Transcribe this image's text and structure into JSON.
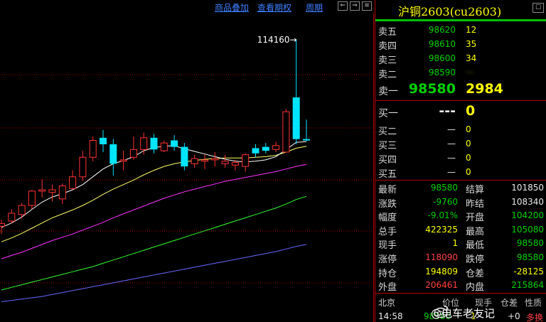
{
  "toolbar": {
    "overlay_label": "商品叠加",
    "periods_label": "查看期权",
    "cycle_label": "周期",
    "nav_left": "⇐",
    "nav_right": "⇒",
    "nav_menu": "≡"
  },
  "chart": {
    "peak_annotation": "114160→"
  },
  "colors": {
    "up_candle": "#ff3333",
    "down_candle": "#00e5ff",
    "ma_fast": "#ffffff",
    "ma_mid": "#ffff66",
    "ma_slow": "#ff33ff",
    "ma_long": "#33ff33",
    "ma_longest": "#6666ff",
    "grid": "#a00000"
  },
  "chart_data": {
    "type": "candlestick",
    "title": "",
    "candles": [
      {
        "o": 85400,
        "h": 86400,
        "l": 84200,
        "c": 85800
      },
      {
        "o": 86200,
        "h": 88000,
        "l": 85800,
        "c": 87400
      },
      {
        "o": 87200,
        "h": 89000,
        "l": 86600,
        "c": 88600
      },
      {
        "o": 88600,
        "h": 91000,
        "l": 88000,
        "c": 90800
      },
      {
        "o": 90800,
        "h": 92600,
        "l": 89800,
        "c": 91000
      },
      {
        "o": 90600,
        "h": 91800,
        "l": 89200,
        "c": 91000
      },
      {
        "o": 89600,
        "h": 92000,
        "l": 88800,
        "c": 91600
      },
      {
        "o": 91200,
        "h": 94000,
        "l": 91000,
        "c": 93000
      },
      {
        "o": 93000,
        "h": 97000,
        "l": 92400,
        "c": 96000
      },
      {
        "o": 96000,
        "h": 99200,
        "l": 95400,
        "c": 98600
      },
      {
        "o": 99000,
        "h": 100200,
        "l": 96800,
        "c": 98000
      },
      {
        "o": 98000,
        "h": 98800,
        "l": 93200,
        "c": 95000
      },
      {
        "o": 95400,
        "h": 97000,
        "l": 94000,
        "c": 95600
      },
      {
        "o": 96000,
        "h": 99200,
        "l": 95600,
        "c": 97200
      },
      {
        "o": 97200,
        "h": 99800,
        "l": 96400,
        "c": 99000
      },
      {
        "o": 99000,
        "h": 99600,
        "l": 96600,
        "c": 97200
      },
      {
        "o": 97000,
        "h": 98600,
        "l": 96800,
        "c": 98200
      },
      {
        "o": 98600,
        "h": 99400,
        "l": 97000,
        "c": 97600
      },
      {
        "o": 97600,
        "h": 98200,
        "l": 94000,
        "c": 94600
      },
      {
        "o": 95000,
        "h": 96400,
        "l": 94400,
        "c": 95800
      },
      {
        "o": 95400,
        "h": 96400,
        "l": 94200,
        "c": 95600
      },
      {
        "o": 95600,
        "h": 96800,
        "l": 94600,
        "c": 95800
      },
      {
        "o": 95000,
        "h": 96400,
        "l": 94400,
        "c": 95400
      },
      {
        "o": 94800,
        "h": 95600,
        "l": 94000,
        "c": 95200
      },
      {
        "o": 94600,
        "h": 96600,
        "l": 93800,
        "c": 96400
      },
      {
        "o": 97400,
        "h": 98000,
        "l": 96000,
        "c": 96600
      },
      {
        "o": 97600,
        "h": 98200,
        "l": 96600,
        "c": 97000
      },
      {
        "o": 97200,
        "h": 98400,
        "l": 96800,
        "c": 97800
      },
      {
        "o": 96800,
        "h": 103400,
        "l": 96800,
        "c": 103000
      },
      {
        "o": 105200,
        "h": 114160,
        "l": 98000,
        "c": 98800
      },
      {
        "o": 98800,
        "h": 101800,
        "l": 98500,
        "c": 98580
      }
    ],
    "ma_fast": [
      85200,
      85900,
      86800,
      88000,
      89100,
      89900,
      90400,
      91000,
      91800,
      93000,
      94200,
      95000,
      95500,
      96100,
      97000,
      97500,
      97700,
      97800,
      97300,
      96900,
      96500,
      96100,
      95700,
      95400,
      95300,
      95400,
      95600,
      96100,
      97200,
      98300,
      98400
    ],
    "ma_mid": [
      83000,
      83600,
      84300,
      85100,
      85900,
      86700,
      87300,
      87900,
      88600,
      89400,
      90300,
      91100,
      91800,
      92500,
      93300,
      94000,
      94600,
      95000,
      95300,
      95500,
      95700,
      95800,
      95900,
      95900,
      95900,
      96000,
      96100,
      96300,
      96800,
      97400,
      97700
    ],
    "ma_slow": [
      80400,
      80900,
      81400,
      82000,
      82600,
      83200,
      83700,
      84200,
      84800,
      85400,
      86000,
      86700,
      87300,
      87900,
      88500,
      89100,
      89700,
      90200,
      90700,
      91100,
      91500,
      91900,
      92300,
      92600,
      92900,
      93200,
      93500,
      93800,
      94200,
      94600,
      94900
    ],
    "ma_long": [
      75600,
      76000,
      76400,
      76800,
      77200,
      77600,
      78000,
      78400,
      78800,
      79200,
      79700,
      80200,
      80700,
      81200,
      81700,
      82200,
      82700,
      83200,
      83700,
      84200,
      84700,
      85200,
      85700,
      86200,
      86700,
      87200,
      87700,
      88200,
      88800,
      89500,
      90000
    ],
    "ma_longest": [
      73800,
      74000,
      74200,
      74400,
      74600,
      74900,
      75200,
      75500,
      75800,
      76100,
      76400,
      76700,
      77000,
      77300,
      77600,
      77900,
      78200,
      78500,
      78800,
      79100,
      79400,
      79700,
      80000,
      80300,
      80600,
      80900,
      81200,
      81500,
      81900,
      82300,
      82600
    ],
    "ylim": [
      71000,
      118000
    ],
    "grid": true
  },
  "panel": {
    "title": "沪铜2603(cu2603)",
    "title_btn": "☐",
    "asks": [
      {
        "label": "卖五",
        "price": "98620",
        "vol": "12"
      },
      {
        "label": "卖四",
        "price": "98610",
        "vol": "35"
      },
      {
        "label": "卖三",
        "price": "98600",
        "vol": "34"
      },
      {
        "label": "卖二",
        "price": "98590",
        "vol": "···"
      },
      {
        "label": "卖一",
        "price": "98580",
        "vol": "2984"
      }
    ],
    "bids": [
      {
        "label": "买一",
        "price": "---",
        "vol": "0"
      },
      {
        "label": "买二",
        "price": "—",
        "vol": "0"
      },
      {
        "label": "买三",
        "price": "—",
        "vol": "0"
      },
      {
        "label": "买四",
        "price": "—",
        "vol": "0"
      },
      {
        "label": "买五",
        "price": "—",
        "vol": "0"
      }
    ],
    "stats": [
      {
        "l1": "最新",
        "v1": "98580",
        "c1": "g",
        "l2": "结算",
        "v2": "101850",
        "c2": "w"
      },
      {
        "l1": "涨跌",
        "v1": "-9760",
        "c1": "g",
        "l2": "昨结",
        "v2": "108340",
        "c2": "w"
      },
      {
        "l1": "幅度",
        "v1": "-9.01%",
        "c1": "g",
        "l2": "开盘",
        "v2": "104200",
        "c2": "g"
      },
      {
        "l1": "总手",
        "v1": "422325",
        "c1": "y",
        "l2": "最高",
        "v2": "105080",
        "c2": "g"
      },
      {
        "l1": "现手",
        "v1": "1",
        "c1": "y",
        "l2": "最低",
        "v2": "98580",
        "c2": "g"
      },
      {
        "l1": "涨停",
        "v1": "118090",
        "c1": "r",
        "l2": "跌停",
        "v2": "98580",
        "c2": "g"
      },
      {
        "l1": "持仓",
        "v1": "194809",
        "c1": "y",
        "l2": "仓差",
        "v2": "-28125",
        "c2": "y"
      },
      {
        "l1": "外盘",
        "v1": "206461",
        "c1": "r",
        "l2": "内盘",
        "v2": "215864",
        "c2": "g"
      }
    ],
    "tick_header": {
      "region": "北京",
      "c1": "价位",
      "c2": "现手",
      "c3": "仓差",
      "c4": "性质"
    },
    "tick_row": {
      "time": "14:58",
      "price": "98580",
      "vol": "1",
      "chg": "+0",
      "type": "多换"
    },
    "watermark": "@电车老友记"
  }
}
